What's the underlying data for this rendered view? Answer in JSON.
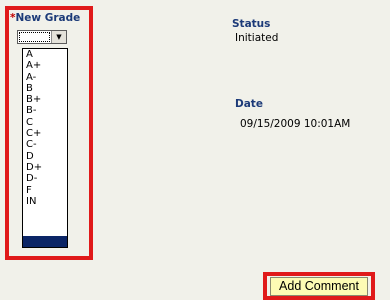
{
  "grade": {
    "required_mark": "*",
    "label": "New Grade",
    "current_value": "",
    "options": [
      "A",
      "A+",
      "A-",
      "B",
      "B+",
      "B-",
      "C",
      "C+",
      "C-",
      "D",
      "D+",
      "D-",
      "F",
      "IN"
    ]
  },
  "status": {
    "label": "Status",
    "value": "Initiated"
  },
  "date": {
    "label": "Date",
    "value": "09/15/2009 10:01AM"
  },
  "actions": {
    "add_comment_label": "Add Comment"
  },
  "colors": {
    "highlight_frame": "#e01a1a",
    "label_blue": "#1c3a78",
    "button_bg": "#fdfbb4",
    "selected_option": "#0b2566"
  }
}
